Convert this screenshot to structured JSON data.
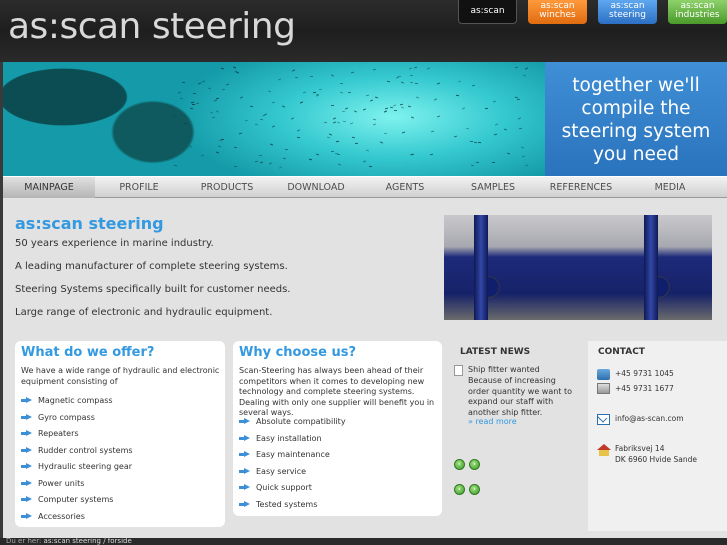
{
  "header": {
    "logo": "as:scan steering",
    "brand_tabs": [
      {
        "line1": "as:scan",
        "line2": ""
      },
      {
        "line1": "as:scan",
        "line2": "winches"
      },
      {
        "line1": "as:scan",
        "line2": "steering"
      },
      {
        "line1": "as:scan",
        "line2": "industries"
      }
    ]
  },
  "banner": {
    "slogan": [
      "together we'll",
      "compile the",
      "steering system",
      "you need"
    ]
  },
  "nav": {
    "items": [
      "MAINPAGE",
      "PROFILE",
      "PRODUCTS",
      "DOWNLOAD",
      "AGENTS",
      "SAMPLES",
      "REFERENCES",
      "MEDIA"
    ],
    "active": "MAINPAGE"
  },
  "intro": {
    "title": "as:scan steering",
    "lines": [
      "50 years experience in marine industry.",
      "A leading manufacturer of complete steering systems.",
      "Steering Systems specifically built for customer needs.",
      "Large range of electronic and hydraulic equipment."
    ]
  },
  "offer": {
    "title": "What do we offer?",
    "text": "We have a wide range of hydraulic and electronic equipment consisting of",
    "items": [
      "Magnetic compass",
      "Gyro compass",
      "Repeaters",
      "Rudder control systems",
      "Hydraulic steering gear",
      "Power units",
      "Computer systems",
      "Accessories"
    ]
  },
  "choose": {
    "title": "Why choose us?",
    "text": "Scan-Steering has always been ahead of their competitors when it comes to developing new technology and complete steering systems. Dealing with only one supplier will benefit you in several ways.",
    "items": [
      "Absolute compatibility",
      "Easy installation",
      "Easy maintenance",
      "Easy service",
      "Quick support",
      "Tested systems"
    ]
  },
  "news": {
    "title": "LATEST NEWS",
    "headline": "Ship fitter wanted",
    "body": "Because of increasing order quantity we want to expand our staff with another ship fitter.",
    "more": "» read more"
  },
  "contact": {
    "title": "CONTACT",
    "phone": "+45 9731 1045",
    "fax": "+45 9731 1677",
    "email": "info@as-scan.com",
    "address1": "Fabriksvej 14",
    "address2": "DK 6960 Hvide Sande"
  },
  "footer": {
    "prefix": "Du er her: ",
    "path": "as:scan steering / forside"
  },
  "colors": {
    "accent": "#3399e0",
    "winches": "#e06c0f",
    "steering": "#2c6fc4",
    "industries": "#4a9a2a"
  }
}
